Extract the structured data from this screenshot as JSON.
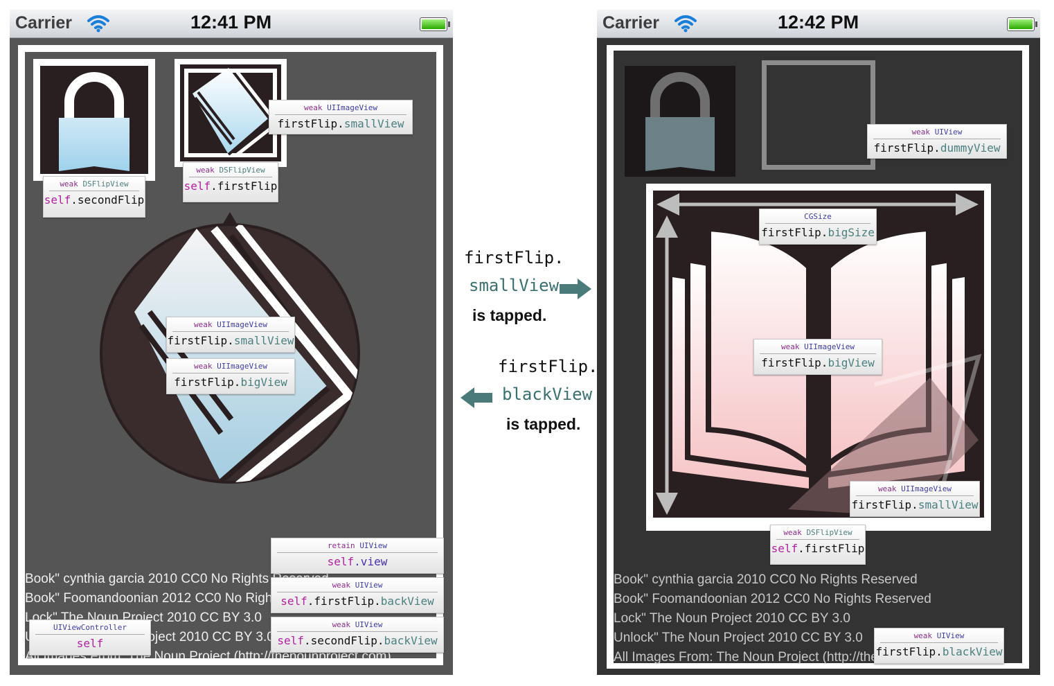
{
  "colors": {
    "arrow": "#4a7a7a",
    "screen_bg": "#555555",
    "frame": "#ffffff",
    "dark_panel": "#2a1f20"
  },
  "left_phone": {
    "carrier": "Carrier",
    "time": "12:41 PM",
    "labels": {
      "second_flip": {
        "type_kw": "weak",
        "type_cls": "DSFlipView",
        "name_kw": "self",
        "name_rest": ".secondFlip"
      },
      "first_flip": {
        "type_kw": "weak",
        "type_cls": "DSFlipView",
        "name_kw": "self",
        "name_rest": ".firstFlip"
      },
      "small_view_top": {
        "type_kw": "weak",
        "type_cls": "UIImageView",
        "name_obj": "firstFlip.",
        "name_prop": "smallView"
      },
      "small_view_mid": {
        "type_kw": "weak",
        "type_cls": "UIImageView",
        "name_obj": "firstFlip.",
        "name_prop": "smallView"
      },
      "big_view_mid": {
        "type_kw": "weak",
        "type_cls": "UIImageView",
        "name_obj": "firstFlip.",
        "name_prop": "bigView"
      },
      "self_view": {
        "type_kw": "retain",
        "type_cls": "UIView",
        "name_kw": "self",
        "name_prop": ".view"
      },
      "first_back": {
        "type_kw": "weak",
        "type_cls": "UIView",
        "name_kw": "self",
        "name_rest": ".firstFlip.",
        "name_prop": "backView"
      },
      "second_back": {
        "type_kw": "weak",
        "type_cls": "UIView",
        "name_kw": "self",
        "name_rest": ".secondFlip.",
        "name_prop": "backView"
      },
      "controller": {
        "type_cls": "UIViewController",
        "name_kw": "self"
      }
    },
    "credits": [
      "Book\" cynthia garcia 2010 CC0 No Rights Reserved",
      "Book\" Foomandoonian 2012 CC0 No Rights Reserved",
      "Lock\" The Noun Project 2010 CC BY 3.0",
      "Unlock\" The Noun Project 2010 CC BY 3.0",
      "All Images From: The Noun Project (http://thenounproject.com)"
    ]
  },
  "middle": {
    "forward": {
      "obj": "firstFlip.",
      "prop": "smallView",
      "action": "is tapped."
    },
    "backward": {
      "obj": "firstFlip.",
      "prop": "blackView",
      "action": "is tapped."
    }
  },
  "right_phone": {
    "carrier": "Carrier",
    "time": "12:42 PM",
    "labels": {
      "dummy_view": {
        "type_kw": "weak",
        "type_cls": "UIView",
        "name_obj": "firstFlip.",
        "name_prop": "dummyView"
      },
      "big_size": {
        "type_cls": "CGSize",
        "name_obj": "firstFlip.",
        "name_prop": "bigSize"
      },
      "big_view": {
        "type_kw": "weak",
        "type_cls": "UIImageView",
        "name_obj": "firstFlip.",
        "name_prop": "bigView"
      },
      "small_view": {
        "type_kw": "weak",
        "type_cls": "UIImageView",
        "name_obj": "firstFlip.",
        "name_prop": "smallView"
      },
      "first_flip": {
        "type_kw": "weak",
        "type_cls": "DSFlipView",
        "name_kw": "self",
        "name_rest": ".firstFlip"
      },
      "black_view": {
        "type_kw": "weak",
        "type_cls": "UIView",
        "name_obj": "firstFlip.",
        "name_prop": "blackView"
      }
    },
    "credits": [
      "Book\" cynthia garcia 2010 CC0 No Rights Reserved",
      "Book\" Foomandoonian 2012 CC0 No Rights Reserved",
      "Lock\" The Noun Project 2010 CC BY 3.0",
      "Unlock\" The Noun Project 2010 CC BY 3.0",
      "All Images From: The Noun Project (http://thenounproject.com)"
    ]
  }
}
